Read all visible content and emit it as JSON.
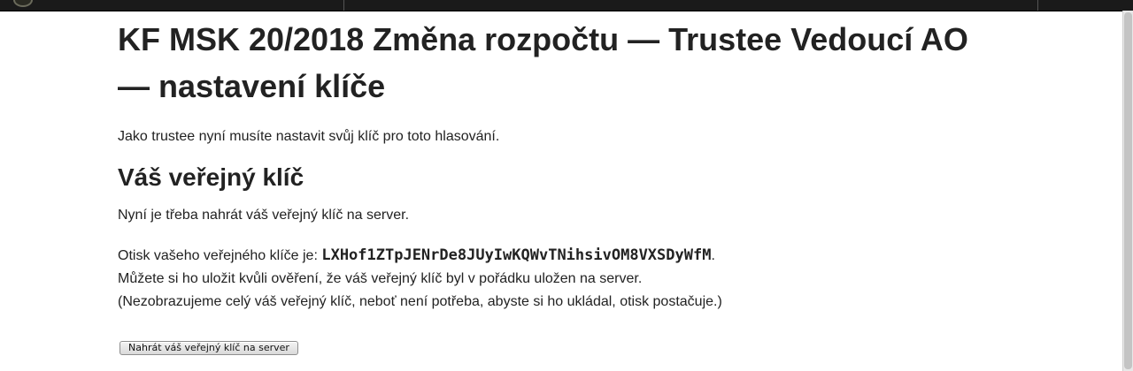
{
  "page": {
    "title": "KF MSK 20/2018 Změna rozpočtu — Trustee Vedoucí AO — nastavení klíče",
    "intro": "Jako trustee nyní musíte nastavit svůj klíč pro toto hlasování."
  },
  "public_key": {
    "heading": "Váš veřejný klíč",
    "upload_note": "Nyní je třeba nahrát váš veřejný klíč na server.",
    "fingerprint_label": "Otisk vašeho veřejného klíče je: ",
    "fingerprint": "LXHof1ZTpJENrDe8JUyIwKQWvTNihsivOM8VXSDyWfM",
    "fingerprint_suffix": ".",
    "save_hint": "Můžete si ho uložit kvůli ověření, že váš veřejný klíč byl v pořádku uložen na server.",
    "explanation": "(Nezobrazujeme celý váš veřejný klíč, neboť není potřeba, abyste si ho ukládal, otisk postačuje.)",
    "upload_button_label": "Nahrát váš veřejný klíč na server"
  }
}
